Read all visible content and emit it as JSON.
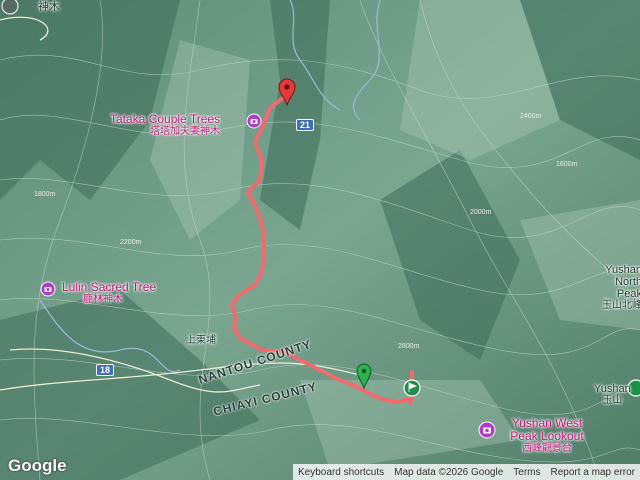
{
  "map": {
    "pois": [
      {
        "name_en": "Tataka Couple Trees",
        "name_zh": "塔塔加夫妻神木",
        "icon": "camera-icon"
      },
      {
        "name_en": "Lulin Sacred Tree",
        "name_zh": "鹿林神木",
        "icon": "camera-icon"
      },
      {
        "name_en": "Yushan West Peak Lookout",
        "name_zh": "西峰觀景台",
        "icon": "camera-icon"
      }
    ],
    "places": {
      "shenmu": "神木",
      "yushan_north_en": "Yushan North Peak",
      "yushan_north_zh": "玉山北峰",
      "yushan_en": "Yushan",
      "yushan_zh": "玉山",
      "shangdongpu": "上東埔"
    },
    "counties": {
      "nantou": "NANTOU COUNTY",
      "chiayi": "CHIAYI COUNTY"
    },
    "routes": {
      "r21": "21",
      "r18": "18"
    },
    "contours": [
      "1800m",
      "2000m",
      "2400m",
      "2800m",
      "2200m",
      "1600m"
    ],
    "track_color": "#f06a6e",
    "start_marker": "green-pin-icon",
    "end_marker": "red-pin-icon",
    "flag_marker": "green-flag-icon"
  },
  "footer": {
    "logo": "Google",
    "keyboard": "Keyboard shortcuts",
    "mapdata": "Map data ©2026 Google",
    "terms": "Terms",
    "report": "Report a map error"
  }
}
